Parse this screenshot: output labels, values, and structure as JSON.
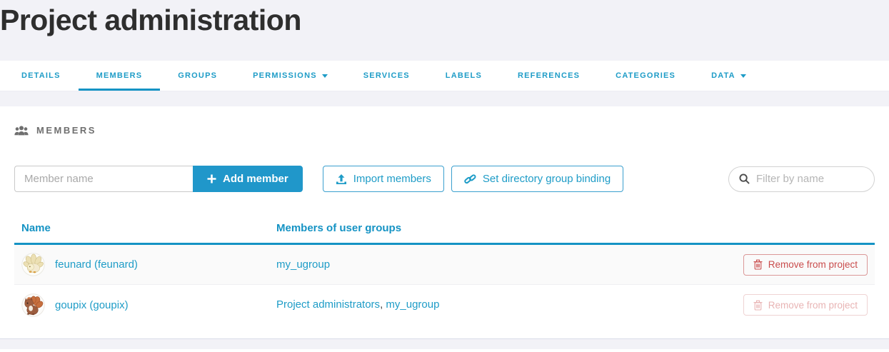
{
  "header": {
    "title": "Project administration"
  },
  "nav": {
    "tabs": [
      {
        "label": "Details",
        "active": false,
        "dropdown": false
      },
      {
        "label": "Members",
        "active": true,
        "dropdown": false
      },
      {
        "label": "Groups",
        "active": false,
        "dropdown": false
      },
      {
        "label": "Permissions",
        "active": false,
        "dropdown": true
      },
      {
        "label": "Services",
        "active": false,
        "dropdown": false
      },
      {
        "label": "Labels",
        "active": false,
        "dropdown": false
      },
      {
        "label": "References",
        "active": false,
        "dropdown": false
      },
      {
        "label": "Categories",
        "active": false,
        "dropdown": false
      },
      {
        "label": "Data",
        "active": false,
        "dropdown": true
      }
    ]
  },
  "members": {
    "section_title": "Members",
    "member_name_placeholder": "Member name",
    "add_member_label": "Add member",
    "import_members_label": "Import members",
    "set_binding_label": "Set directory group binding",
    "filter_placeholder": "Filter by name"
  },
  "table": {
    "col_name": "Name",
    "col_groups": "Members of user groups",
    "group_separator": ", ",
    "rows": [
      {
        "name": "feunard (feunard)",
        "groups": [
          "my_ugroup"
        ],
        "remove_label": "Remove from project",
        "disabled": false
      },
      {
        "name": "goupix (goupix)",
        "groups": [
          "Project administrators",
          "my_ugroup"
        ],
        "remove_label": "Remove from project",
        "disabled": true
      }
    ]
  },
  "colors": {
    "primary": "#1e9cc7",
    "table_header": "#1593c4",
    "danger": "#c94c4c"
  }
}
